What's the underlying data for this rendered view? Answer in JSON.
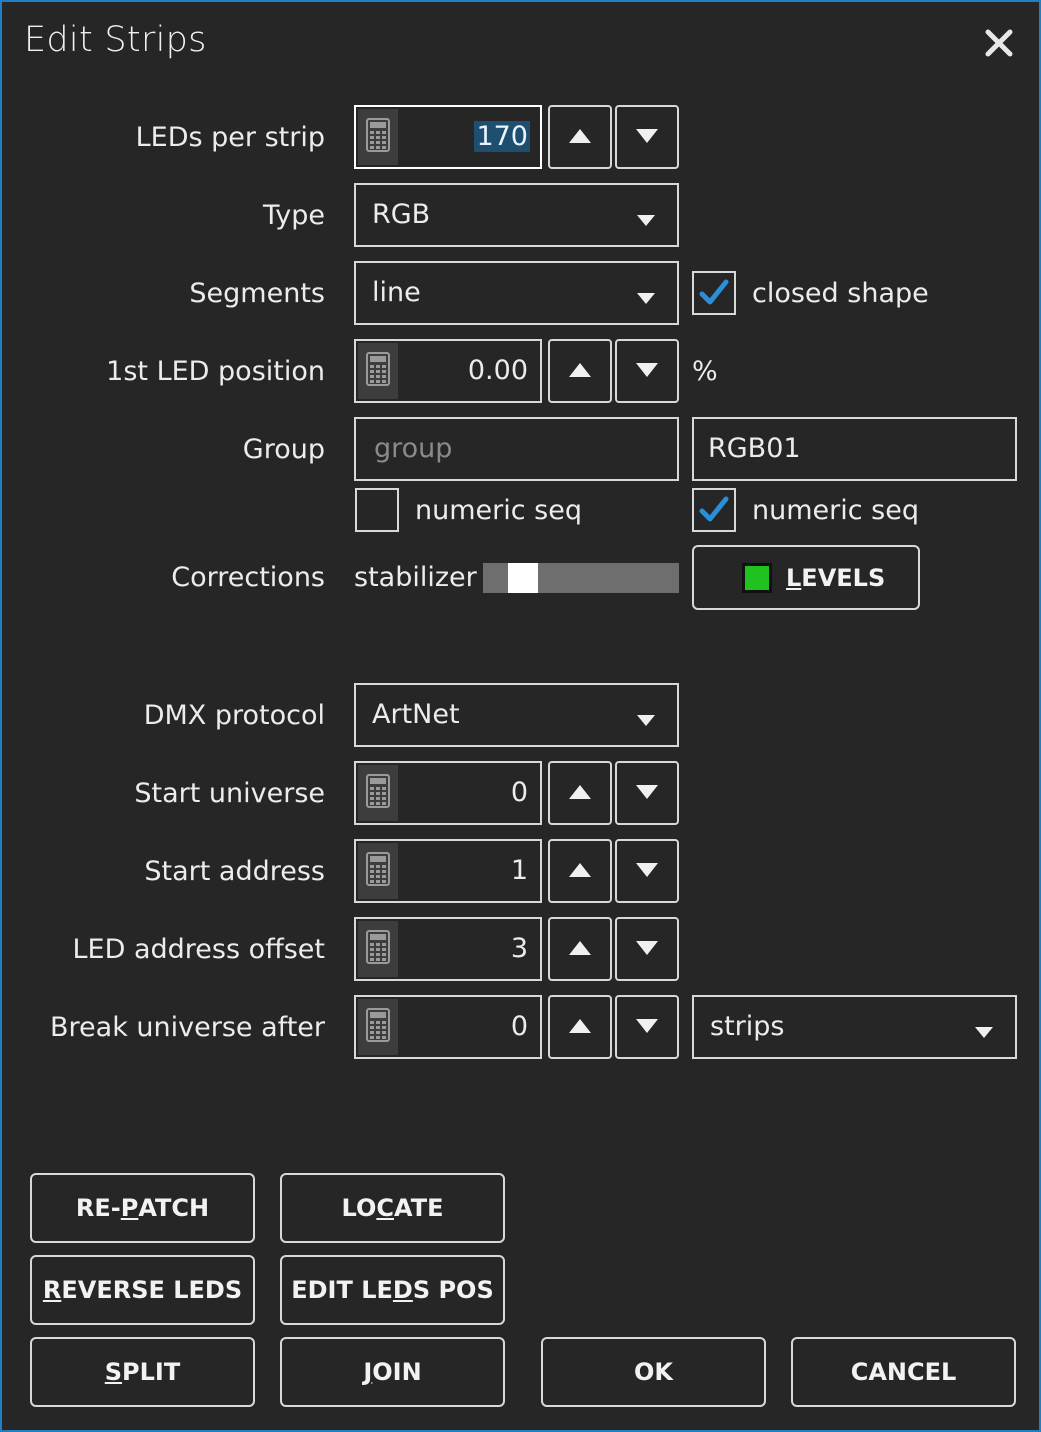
{
  "dialog": {
    "title": "Edit Strips",
    "close_icon": "close-x-icon"
  },
  "fields": {
    "leds_per_strip": {
      "label": "LEDs per strip",
      "value": "170"
    },
    "type": {
      "label": "Type",
      "value": "RGB"
    },
    "segments": {
      "label": "Segments",
      "value": "line",
      "closed_shape_label": "closed shape",
      "closed_shape_checked": true
    },
    "first_led_position": {
      "label": "1st LED position",
      "value": "0.00",
      "unit": "%"
    },
    "group": {
      "label": "Group",
      "left_placeholder": "group",
      "right_value": "RGB01",
      "left_numeric_seq_label": "numeric seq",
      "left_numeric_seq_checked": false,
      "right_numeric_seq_label": "numeric seq",
      "right_numeric_seq_checked": true
    },
    "corrections": {
      "label": "Corrections",
      "stabilizer_label": "stabilizer",
      "stabilizer_level": 0.15,
      "levels_button": {
        "pre": "",
        "key": "L",
        "post": "EVELS"
      },
      "levels_color": "#1fc21f"
    },
    "dmx_protocol": {
      "label": "DMX protocol",
      "value": "ArtNet"
    },
    "start_universe": {
      "label": "Start universe",
      "value": "0"
    },
    "start_address": {
      "label": "Start address",
      "value": "1"
    },
    "led_address_offset": {
      "label": "LED address offset",
      "value": "3"
    },
    "break_universe_after": {
      "label": "Break universe after",
      "value": "0",
      "unit_value": "strips"
    }
  },
  "buttons": {
    "repatch": {
      "pre": "RE-",
      "key": "P",
      "post": "ATCH"
    },
    "locate": {
      "pre": "LO",
      "key": "C",
      "post": "ATE"
    },
    "reverse_leds": {
      "pre": "",
      "key": "R",
      "post": "EVERSE LEDS"
    },
    "edit_leds_pos": {
      "pre": "EDIT LE",
      "key": "D",
      "post": "S POS"
    },
    "split": {
      "pre": "",
      "key": "S",
      "post": "PLIT"
    },
    "join": {
      "pre": "",
      "key": "J",
      "post": "OIN"
    },
    "ok": {
      "pre": "OK",
      "key": "",
      "post": ""
    },
    "cancel": {
      "pre": "CANCEL",
      "key": "",
      "post": ""
    }
  },
  "colors": {
    "accent_border": "#1f7fc4",
    "background": "#262626",
    "check_color": "#2a8fd6"
  }
}
